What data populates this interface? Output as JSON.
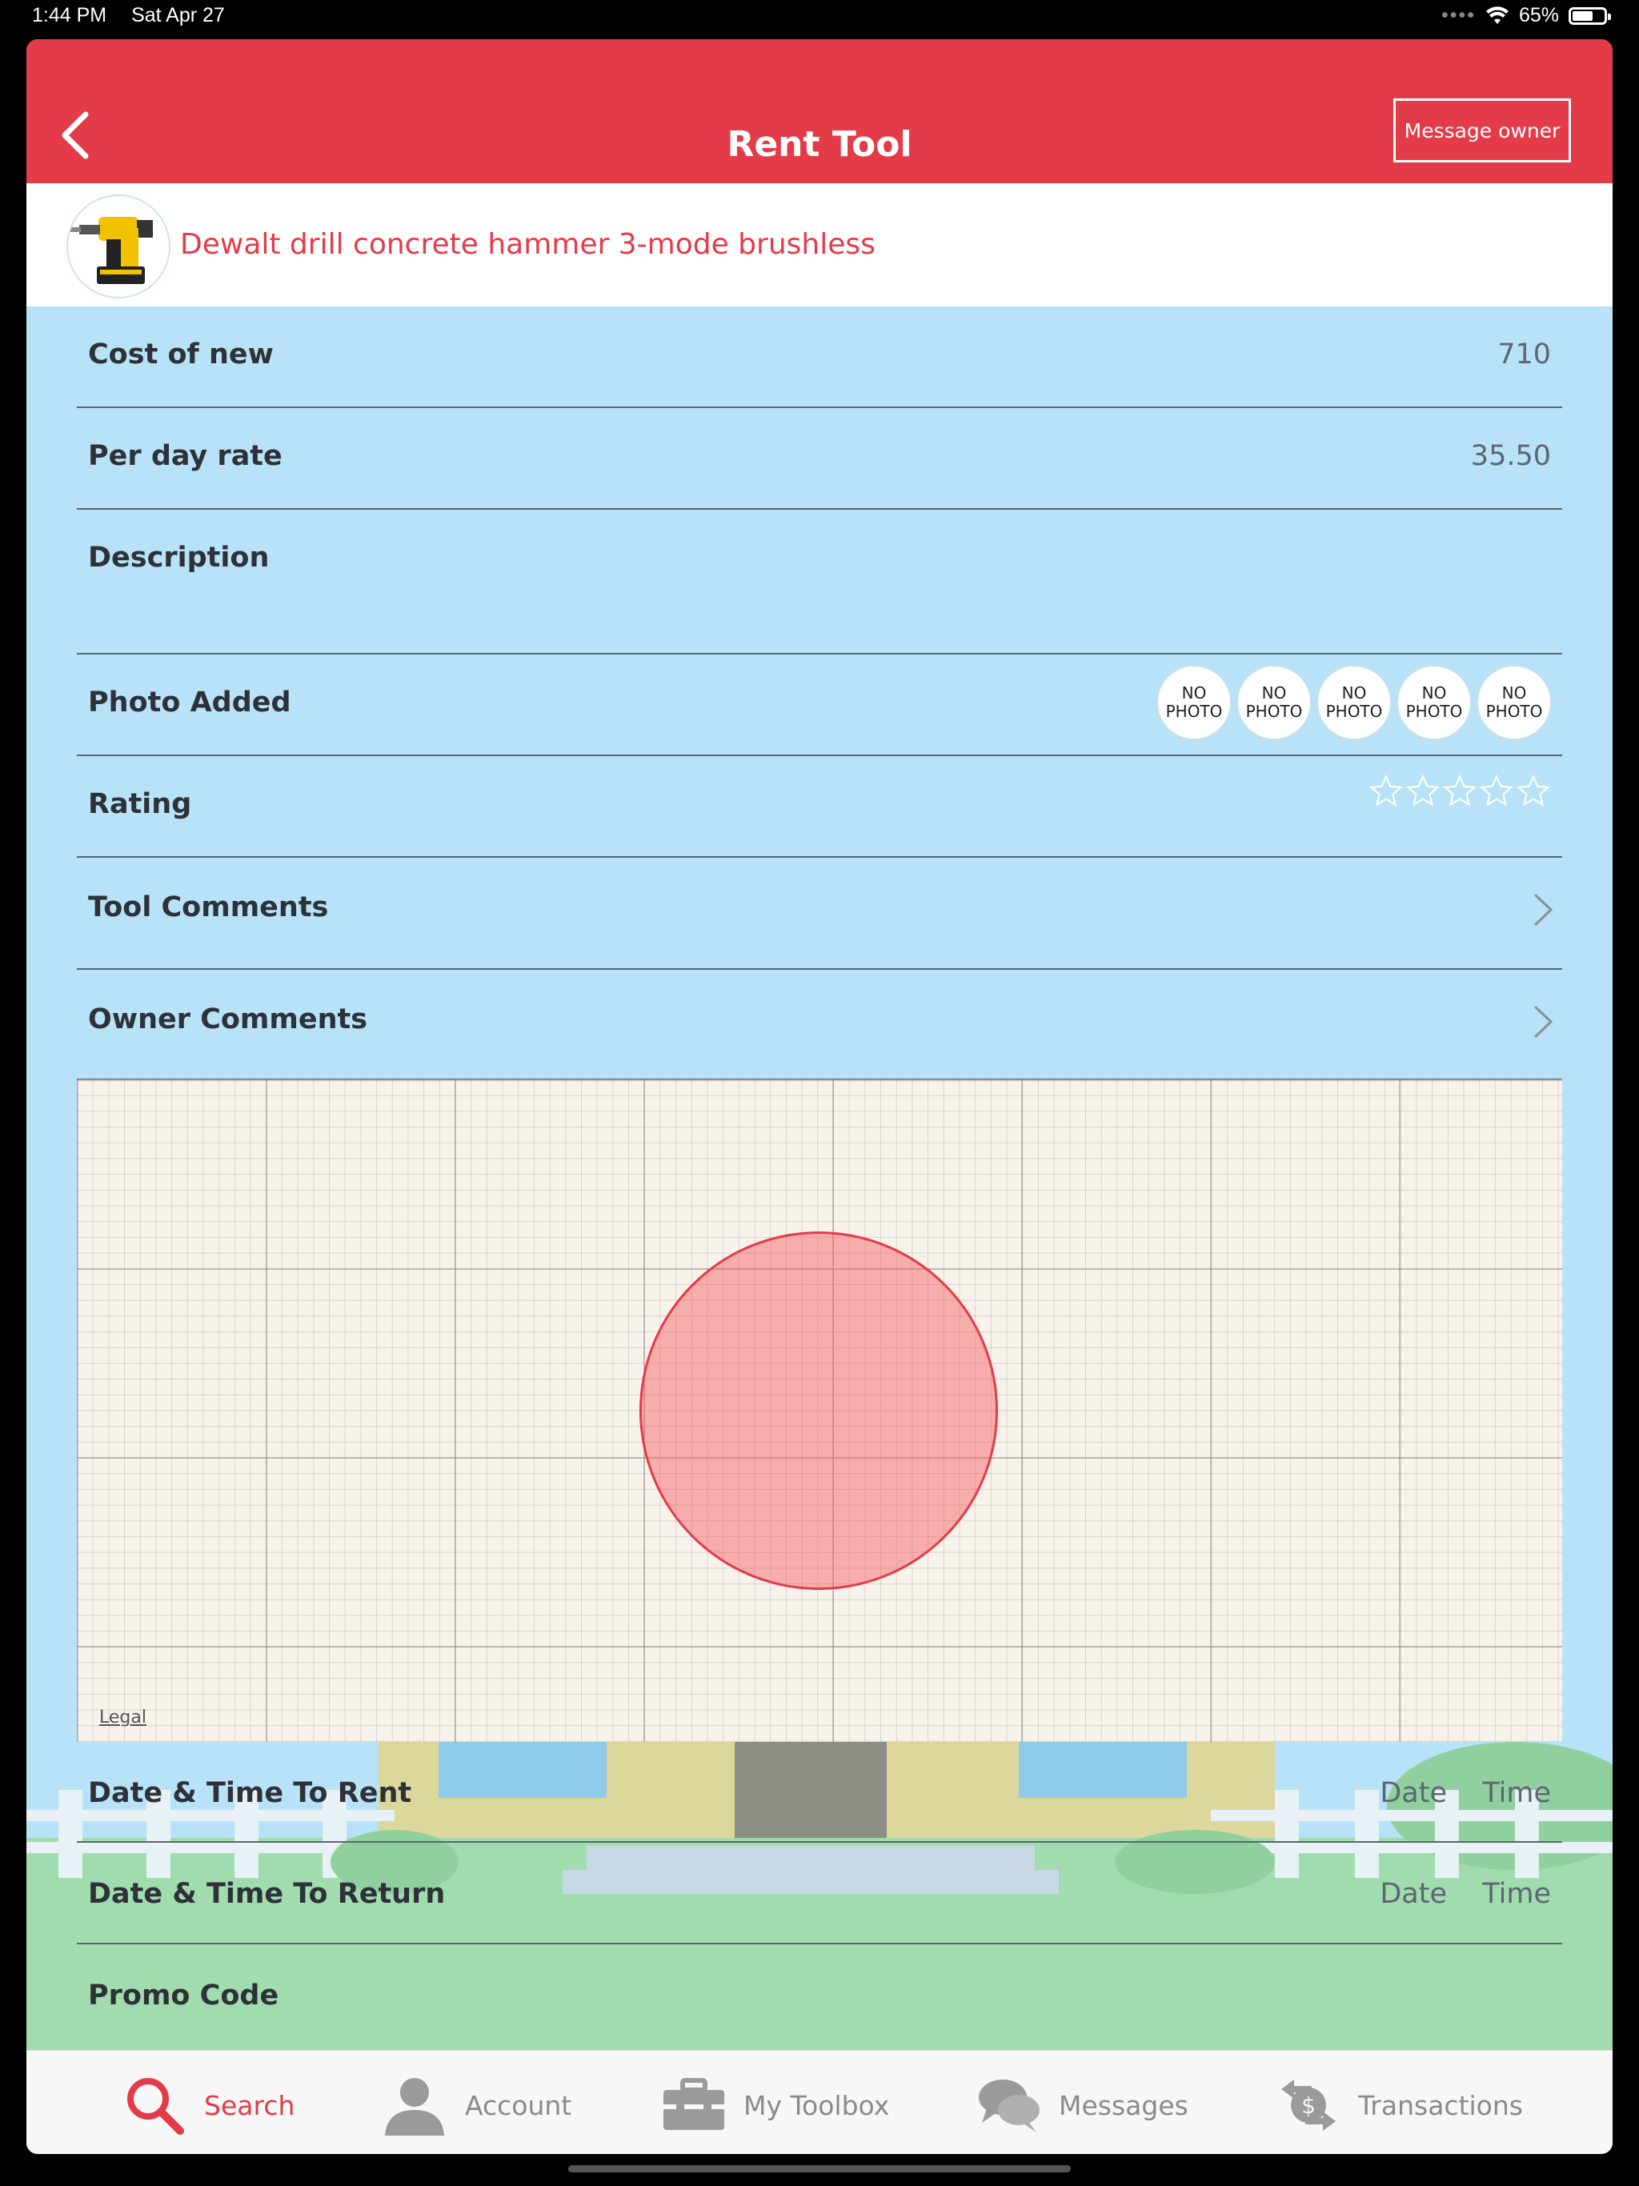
{
  "status_bar": {
    "time": "1:44 PM",
    "date": "Sat Apr 27",
    "battery": "65%",
    "battery_level": 0.65
  },
  "header": {
    "title": "Rent Tool",
    "message_owner_label": "Message owner",
    "accent_color": "#e33b48"
  },
  "tool": {
    "name": "Dewalt drill concrete hammer 3-mode brushless"
  },
  "fields": {
    "cost_of_new": {
      "label": "Cost of new",
      "value": "710"
    },
    "per_day_rate": {
      "label": "Per day rate",
      "value": "35.50"
    },
    "description": {
      "label": "Description",
      "value": ""
    },
    "photo_added": {
      "label": "Photo Added",
      "photos": [
        {
          "line1": "NO",
          "line2": "PHOTO"
        },
        {
          "line1": "NO",
          "line2": "PHOTO"
        },
        {
          "line1": "NO",
          "line2": "PHOTO"
        },
        {
          "line1": "NO",
          "line2": "PHOTO"
        },
        {
          "line1": "NO",
          "line2": "PHOTO"
        }
      ]
    },
    "rating": {
      "label": "Rating",
      "stars_filled": 0,
      "stars_total": 5
    },
    "tool_comments": {
      "label": "Tool Comments"
    },
    "owner_comments": {
      "label": "Owner Comments"
    },
    "date_time_rent": {
      "label": "Date & Time To Rent",
      "date": "Date",
      "time": "Time"
    },
    "date_time_return": {
      "label": "Date & Time To Return",
      "date": "Date",
      "time": "Time"
    },
    "promo_code": {
      "label": "Promo Code",
      "value": ""
    }
  },
  "map": {
    "legal_label": "Legal"
  },
  "tabs": [
    {
      "label": "Search",
      "icon": "search-icon",
      "active": true
    },
    {
      "label": "Account",
      "icon": "account-icon",
      "active": false
    },
    {
      "label": "My Toolbox",
      "icon": "toolbox-icon",
      "active": false
    },
    {
      "label": "Messages",
      "icon": "messages-icon",
      "active": false
    },
    {
      "label": "Transactions",
      "icon": "transactions-icon",
      "active": false
    }
  ]
}
